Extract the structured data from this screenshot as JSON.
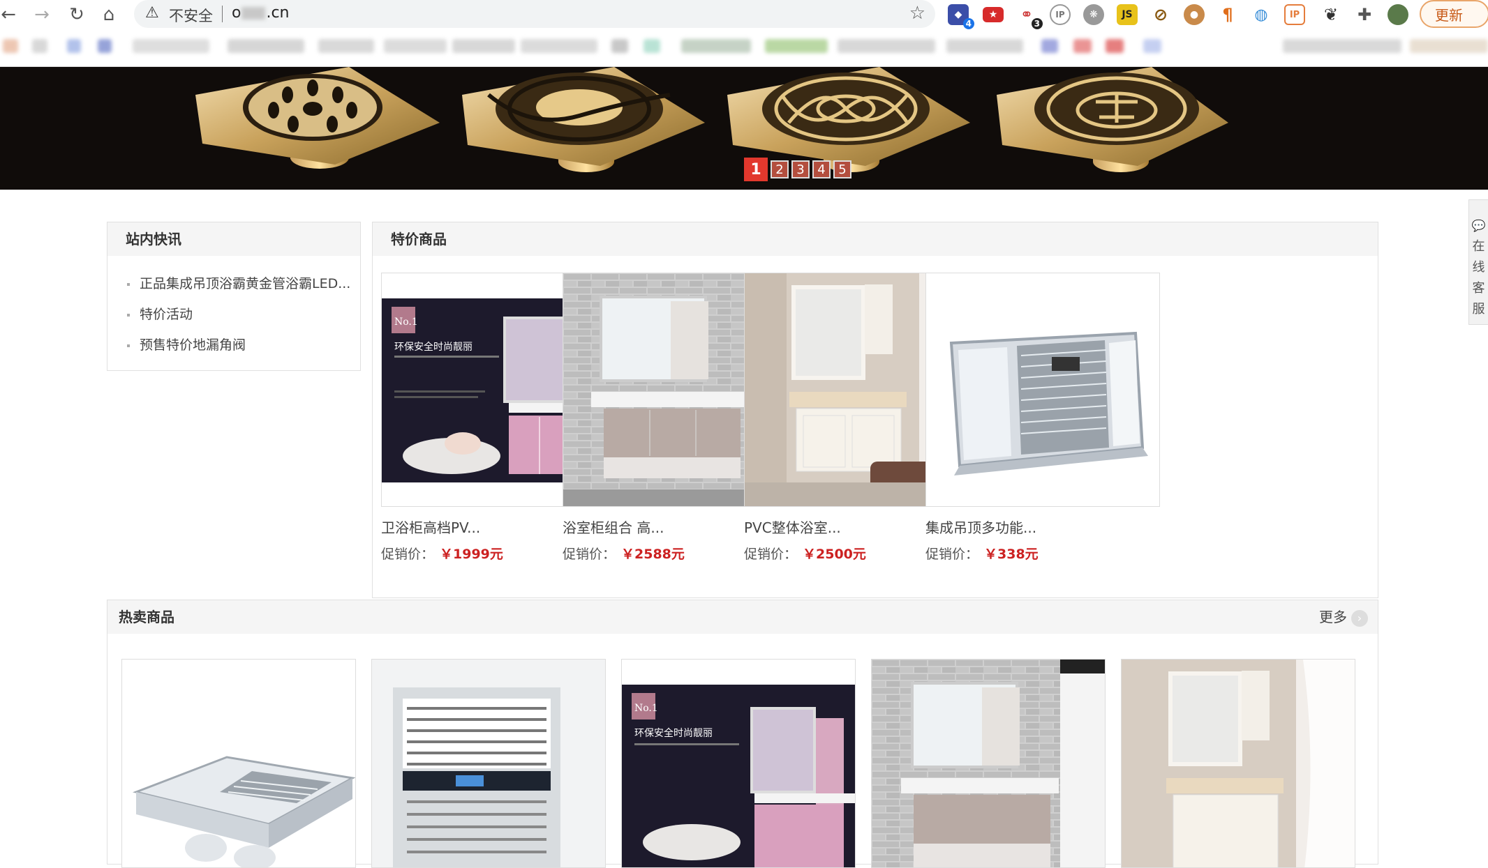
{
  "browser": {
    "security_label": "不安全",
    "url_prefix": "o",
    "url_suffix": ".cn",
    "update_label": "更新",
    "extension_badges": [
      "4",
      "3"
    ]
  },
  "banner": {
    "slides": [
      "1",
      "2",
      "3",
      "4",
      "5"
    ],
    "active_slide": "1"
  },
  "news": {
    "title": "站内快讯",
    "items": [
      "正品集成吊顶浴霸黄金管浴霸LED...",
      "特价活动",
      "预售特价地漏角阀"
    ]
  },
  "special": {
    "title": "特价商品",
    "price_label": "促销价：",
    "products": [
      {
        "name": "卫浴柜高档PV...",
        "price": "￥1999元",
        "image": "pink-bathroom-cabinet"
      },
      {
        "name": "浴室柜组合 高...",
        "price": "￥2588元",
        "image": "brick-wall-bathroom-cabinet"
      },
      {
        "name": "PVC整体浴室...",
        "price": "￥2500元",
        "image": "white-classic-bathroom-cabinet"
      },
      {
        "name": "集成吊顶多功能...",
        "price": "￥338元",
        "image": "ceiling-heater-unit"
      }
    ]
  },
  "hot": {
    "title": "热卖商品",
    "more_label": "更多",
    "items": [
      "ceiling-heater-unit",
      "ceiling-ventilation-grille",
      "pink-bathroom-cabinet",
      "brick-wall-bathroom-cabinet",
      "white-classic-bathroom-cabinet"
    ]
  },
  "service_tab": {
    "chars": [
      "在",
      "线",
      "客",
      "服"
    ]
  },
  "pink_ad": {
    "badge": "No.1",
    "headline": "环保安全时尚靓丽"
  },
  "colors": {
    "price_red": "#cc2121",
    "active_slide": "#e2382d",
    "update_orange": "#c75a18"
  }
}
